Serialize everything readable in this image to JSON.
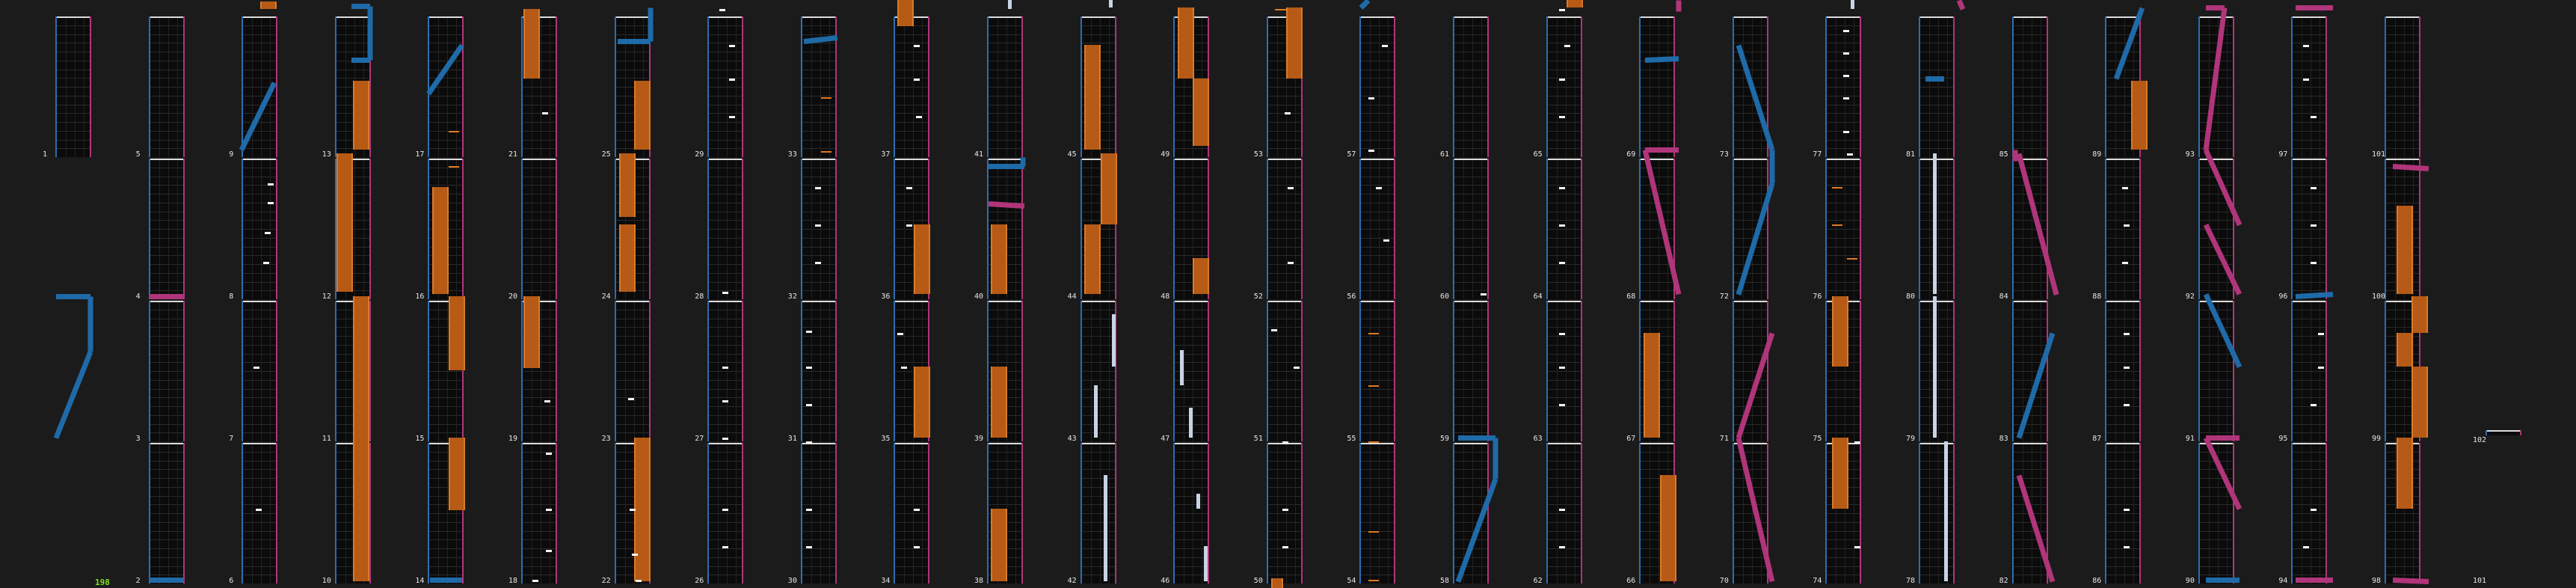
{
  "combo_label": "198",
  "colors": {
    "left_lane": "#2d6db0",
    "right_lane": "#b0357a",
    "hold": "#b65a16",
    "tap": "#f4f4f4",
    "combo": "#7ee01a"
  },
  "measure_labels": [
    "1",
    "2",
    "3",
    "4",
    "5",
    "6",
    "7",
    "8",
    "9",
    "10",
    "11",
    "12",
    "13",
    "14",
    "15",
    "16",
    "17",
    "18",
    "19",
    "20",
    "21",
    "22",
    "23",
    "24",
    "25",
    "26",
    "27",
    "28",
    "29",
    "30",
    "31",
    "32",
    "33",
    "34",
    "35",
    "36",
    "37",
    "38",
    "39",
    "40",
    "41",
    "42",
    "43",
    "44",
    "45",
    "46",
    "47",
    "48",
    "49",
    "50",
    "51",
    "52",
    "53",
    "54",
    "55",
    "56",
    "57",
    "58",
    "59",
    "60",
    "61",
    "62",
    "63",
    "64",
    "65",
    "66",
    "67",
    "68",
    "69",
    "70",
    "71",
    "72",
    "73",
    "74",
    "75",
    "76",
    "77",
    "78",
    "79",
    "80",
    "81",
    "82",
    "83",
    "84",
    "85",
    "86",
    "87",
    "88",
    "89",
    "90",
    "91",
    "92",
    "93",
    "94",
    "95",
    "96",
    "97",
    "98",
    "99",
    "100",
    "101",
    "102",
    "103"
  ]
}
